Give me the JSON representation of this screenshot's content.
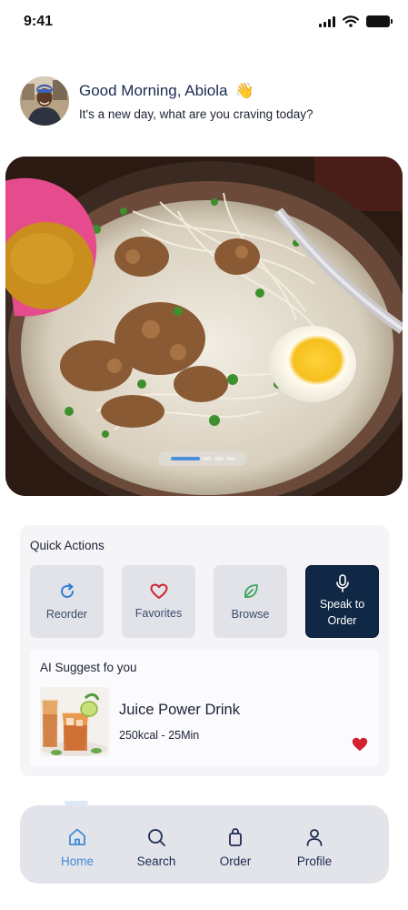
{
  "status_bar": {
    "time": "9:41",
    "icons": [
      "signal-icon",
      "wifi-icon",
      "battery-icon"
    ]
  },
  "greeting": {
    "title": "Good Morning, Abiola",
    "emoji": "👋",
    "subtitle": "It's a new day, what are you craving today?"
  },
  "hero": {
    "image": "noodle-soup-bowl",
    "carousel": {
      "total": 4,
      "active_index": 0
    }
  },
  "quick_actions": {
    "title": "Quick Actions",
    "items": [
      {
        "label": "Reorder",
        "icon": "refresh-icon",
        "color": "#2e7fd4"
      },
      {
        "label": "Favorites",
        "icon": "heart-outline-icon",
        "color": "#d2202f"
      },
      {
        "label": "Browse",
        "icon": "leaf-icon",
        "color": "#3ba55c"
      },
      {
        "label_line1": "Speak to",
        "label_line2": "Order",
        "icon": "microphone-icon",
        "color": "#ffffff"
      }
    ]
  },
  "ai_suggest": {
    "title": "AI Suggest fo you",
    "item": {
      "name": "Juice Power Drink",
      "meta": "250kcal - 25Min",
      "favorite": true
    }
  },
  "bottom_nav": {
    "items": [
      {
        "label": "Home",
        "icon": "home-icon",
        "active": true
      },
      {
        "label": "Search",
        "icon": "search-icon",
        "active": false
      },
      {
        "label": "Order",
        "icon": "bag-icon",
        "active": false
      },
      {
        "label": "Profile",
        "icon": "user-icon",
        "active": false
      }
    ]
  },
  "colors": {
    "accent": "#3d8ad8",
    "dark_button": "#102845",
    "heart": "#d2202f",
    "card_bg": "#f5f5f8",
    "nav_bg": "#e3e4ea"
  }
}
